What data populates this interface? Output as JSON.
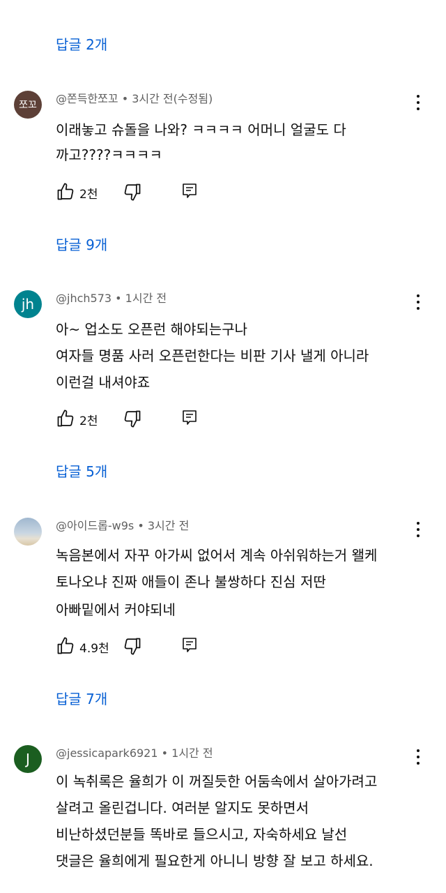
{
  "top_replies": {
    "label": "답글 2개"
  },
  "comments": [
    {
      "avatar_text": "쪼꼬",
      "avatar_color": "#5d4037",
      "author": "@쫀득한쪼꼬",
      "meta": "3시간 전(수정됨)",
      "lines": [
        "이래놓고 슈돌을 나와? ㅋㅋㅋㅋ 어머니 얼굴도 다",
        "까고????ㅋㅋㅋㅋ"
      ],
      "likes": "2천",
      "replies_label": "답글 9개"
    },
    {
      "avatar_text": "jh",
      "avatar_color": "#00838f",
      "author": "@jhch573",
      "meta": "1시간 전",
      "lines": [
        "아~ 업소도 오픈런 해야되는구나",
        "여자들 명품 사러 오픈런한다는 비판 기사 낼게 아니라",
        "이런걸 내셔야죠"
      ],
      "likes": "2천",
      "replies_label": "답글 5개"
    },
    {
      "avatar_text": "",
      "avatar_color": "#b0bec5",
      "author": "@아이드롭-w9s",
      "meta": "3시간 전",
      "lines": [
        "녹음본에서 자꾸 아가씨 없어서 계속 아쉬워하는거 왤케",
        "토나오냐 진짜 애들이 존나 불쌍하다 진심 저딴",
        "아빠밑에서 커야되네"
      ],
      "likes": "4.9천",
      "replies_label": "답글 7개"
    },
    {
      "avatar_text": "J",
      "avatar_color": "#1b5e20",
      "author": "@jessicapark6921",
      "meta": "1시간 전",
      "lines": [
        "이 녹취록은 율희가 이 꺼질듯한 어둠속에서 살아가려고",
        "살려고 올린겁니다. 여러분 알지도 못하면서",
        "비난하셨던분들 똑바로 들으시고, 자숙하세요  날선",
        "댓글은 율희에게 필요한게 아니니 방향 잘 보고 하세요."
      ]
    }
  ]
}
